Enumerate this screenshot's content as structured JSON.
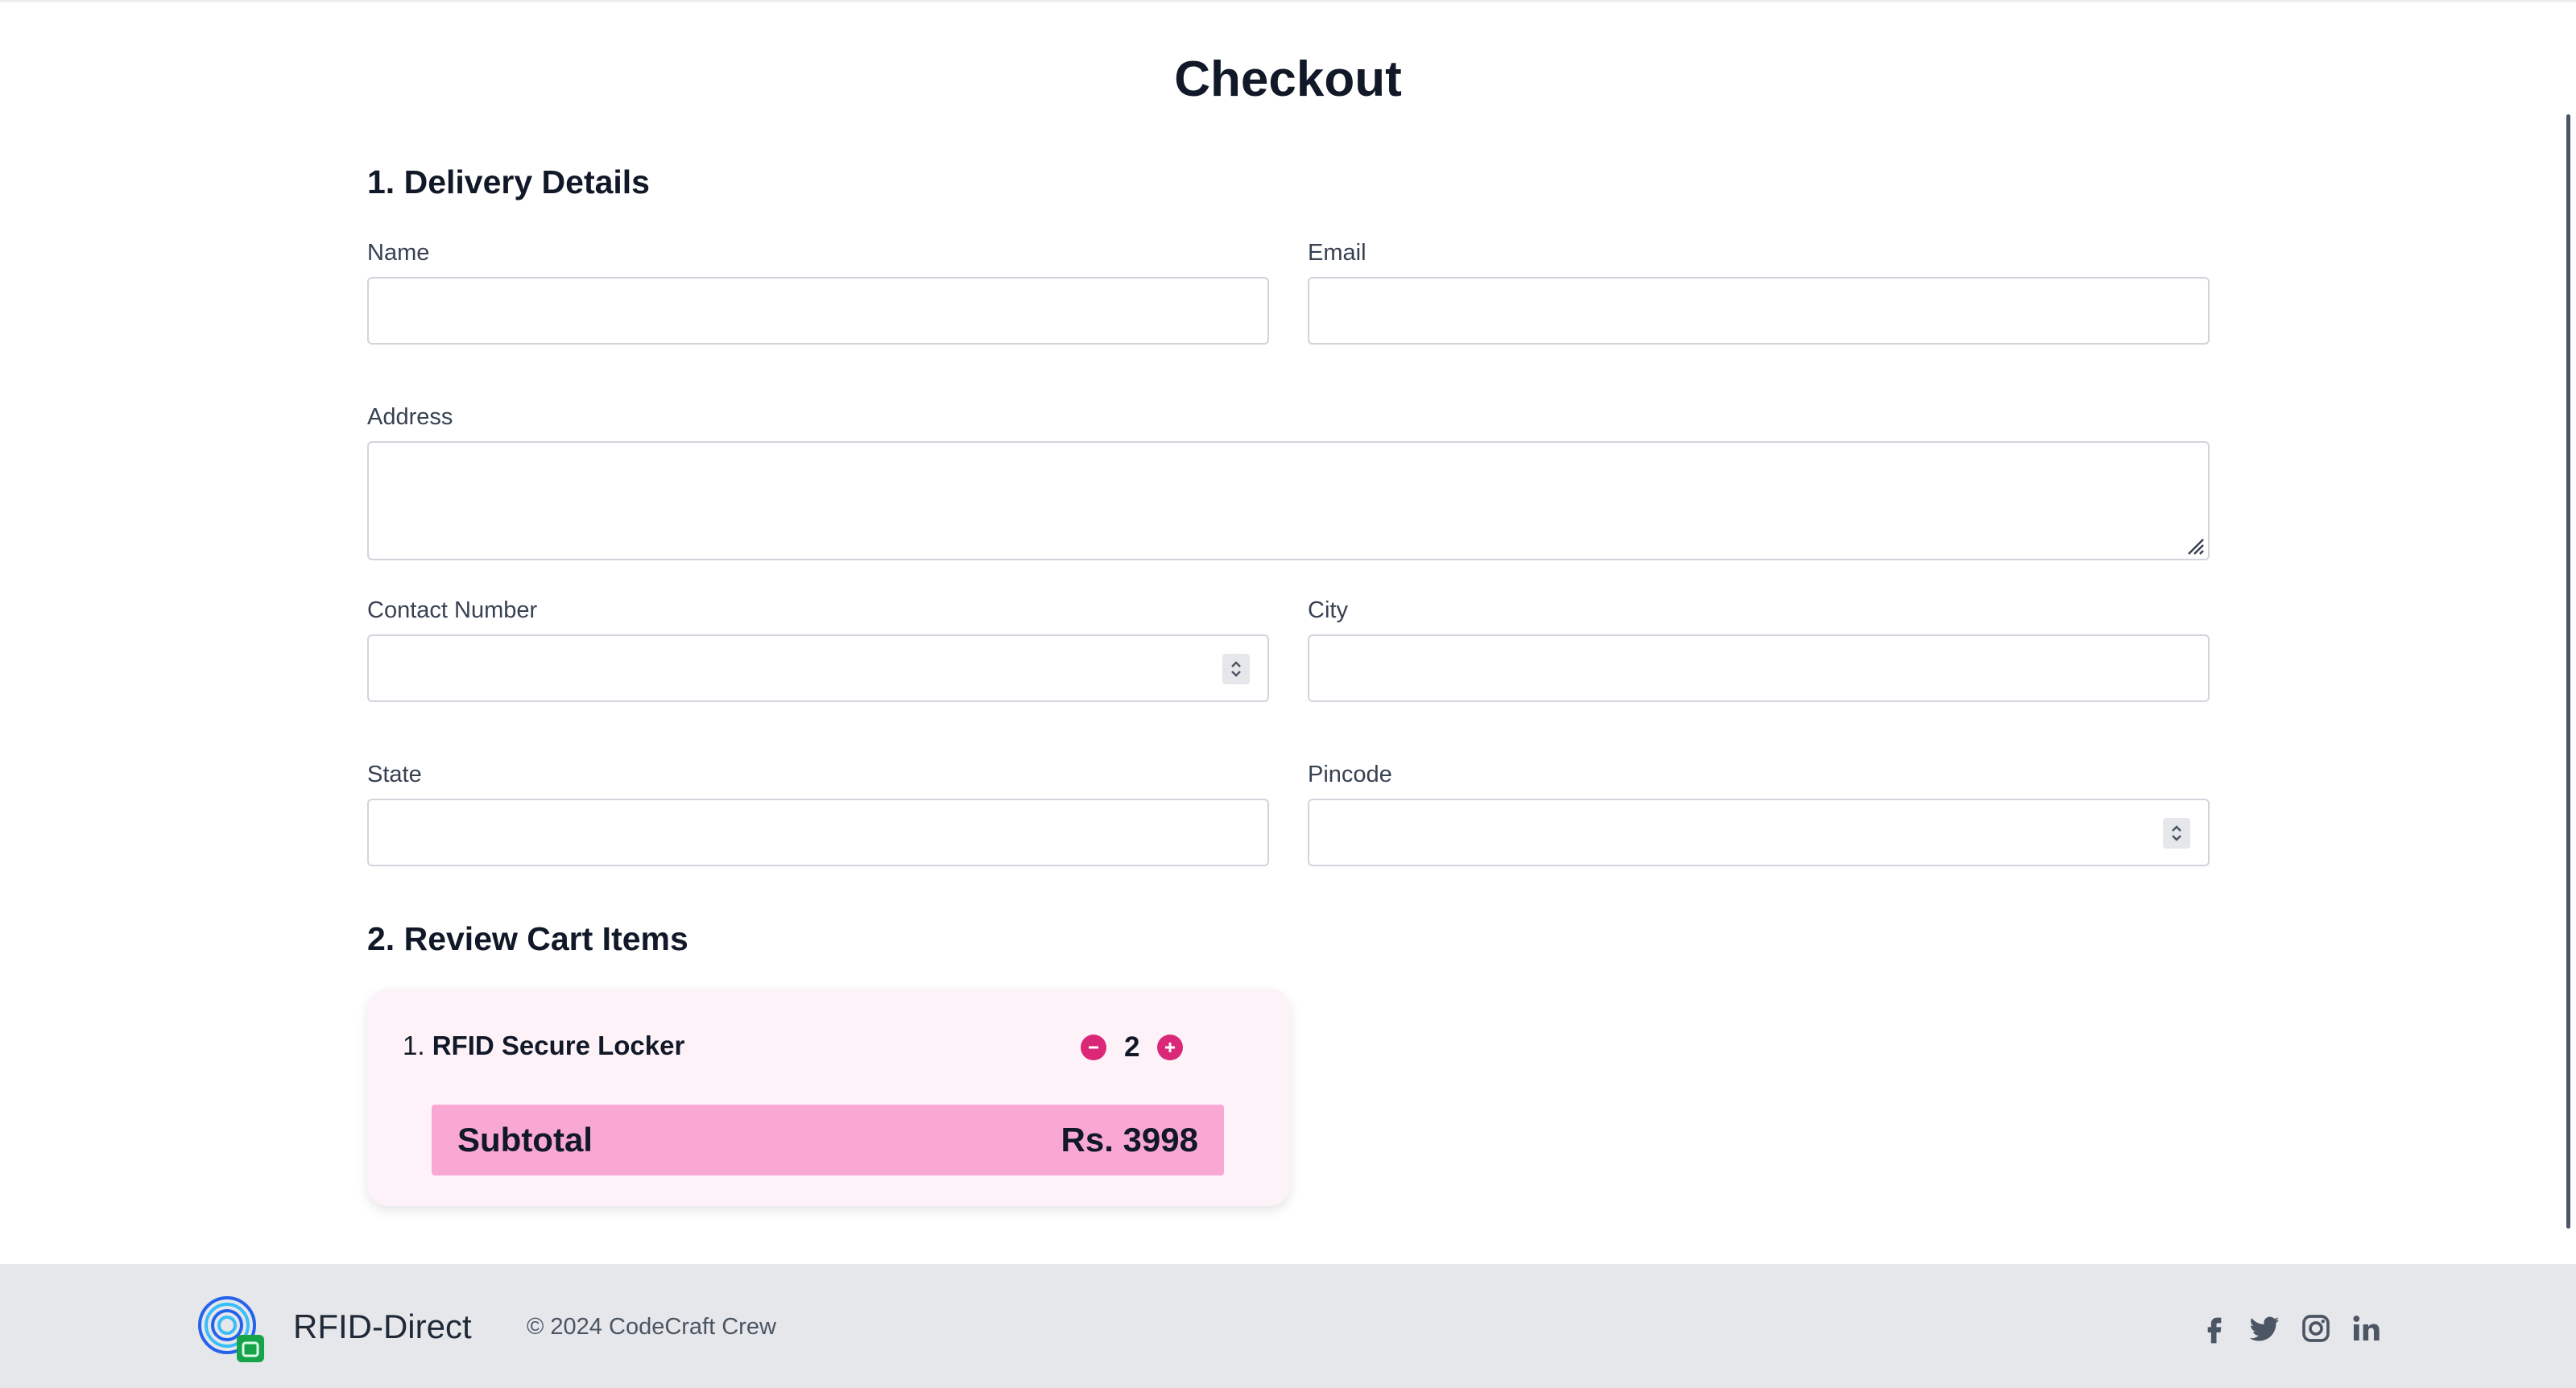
{
  "page": {
    "title": "Checkout"
  },
  "delivery": {
    "heading": "1. Delivery Details",
    "fields": {
      "name": {
        "label": "Name",
        "value": ""
      },
      "email": {
        "label": "Email",
        "value": ""
      },
      "address": {
        "label": "Address",
        "value": ""
      },
      "contact": {
        "label": "Contact Number",
        "value": ""
      },
      "city": {
        "label": "City",
        "value": ""
      },
      "state": {
        "label": "State",
        "value": ""
      },
      "pincode": {
        "label": "Pincode",
        "value": ""
      }
    }
  },
  "cart": {
    "heading": "2. Review Cart Items",
    "items": [
      {
        "index": "1.",
        "name": "RFID Secure Locker",
        "quantity": "2"
      }
    ],
    "subtotal_label": "Subtotal",
    "subtotal_value": "Rs. 3998"
  },
  "footer": {
    "brand": "RFID-Direct",
    "copyright": "© 2024 CodeCraft Crew",
    "social_icons": [
      "facebook-icon",
      "twitter-icon",
      "instagram-icon",
      "linkedin-icon"
    ]
  },
  "colors": {
    "accent": "#db2777",
    "cart_bg": "#fdf2f8",
    "subtotal_bg": "#f9a8d4",
    "footer_bg": "#e5e7eb"
  }
}
